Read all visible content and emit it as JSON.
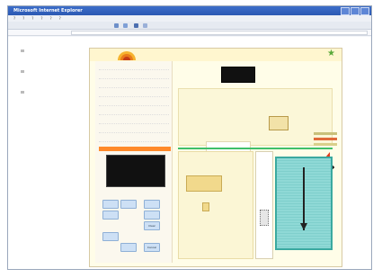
{
  "browser": {
    "title": "Microsoft Internet Explorer",
    "menu_items": [
      "?",
      "?",
      "?",
      "?",
      "?",
      "?"
    ],
    "address": ""
  },
  "app": {
    "title": "",
    "left_panel": {
      "form_rows": [
        "",
        "",
        "",
        "",
        "",
        "",
        "",
        "",
        ""
      ],
      "red_bar_label": "",
      "keypad_buttons": [
        "",
        "",
        "",
        "",
        "",
        "Clear",
        "",
        "",
        "Cancel"
      ]
    },
    "main": {
      "status_lines": [
        "",
        "",
        ""
      ]
    }
  },
  "colors": {
    "title_bar": "#2b59b3",
    "app_background": "#fffde8",
    "accent_orange": "#ff8a2a",
    "teal_panel": "#8fd9d6",
    "green_line": "#3fbf6a",
    "red_marker": "#e23b1b"
  },
  "icons": {
    "logo": "sun-logo-icon",
    "star": "star-icon",
    "marker": "red-triangle-icon"
  }
}
